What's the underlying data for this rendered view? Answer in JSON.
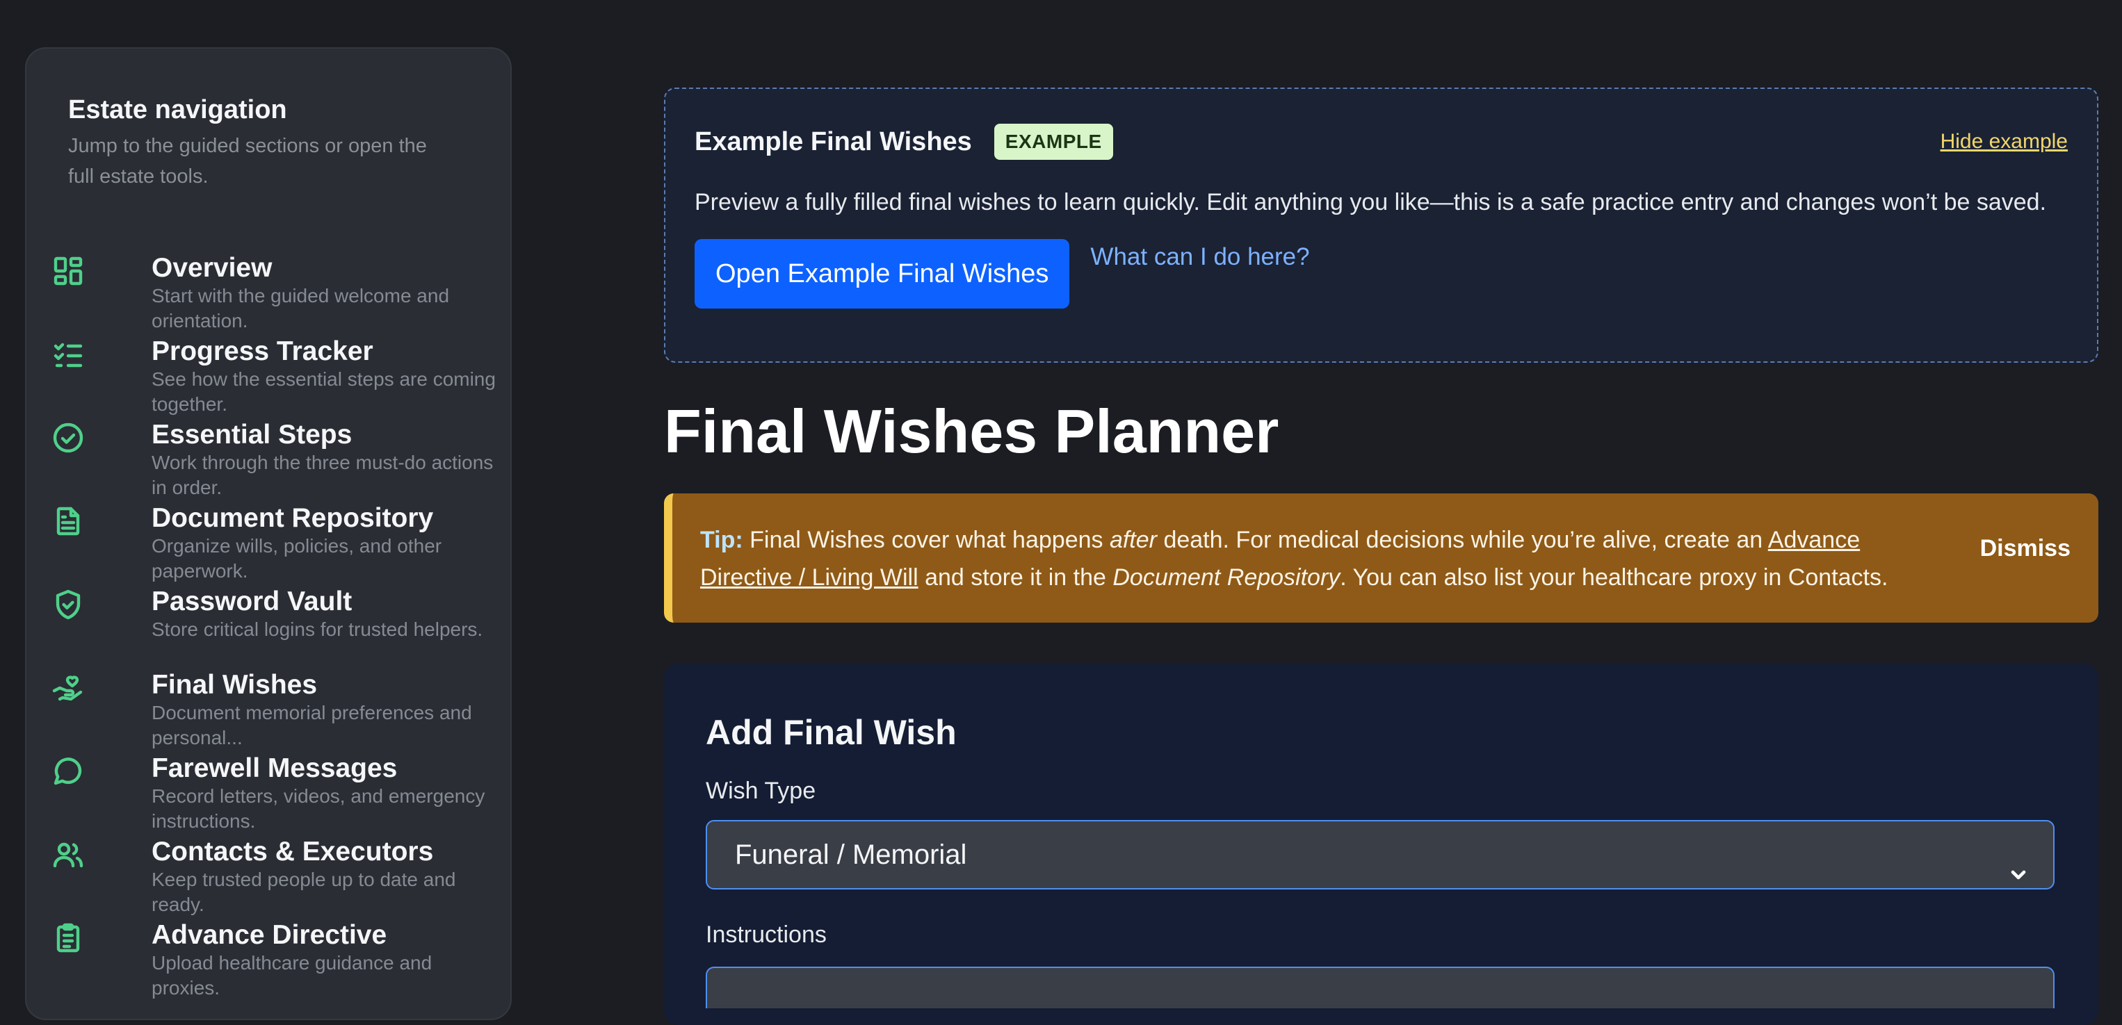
{
  "sidebar": {
    "title": "Estate navigation",
    "subtitle": "Jump to the guided sections or open the full estate tools.",
    "items": [
      {
        "label": "Overview",
        "desc": "Start with the guided welcome and orientation.",
        "icon": "grid-icon"
      },
      {
        "label": "Progress Tracker",
        "desc": "See how the essential steps are coming together.",
        "icon": "checklist-icon"
      },
      {
        "label": "Essential Steps",
        "desc": "Work through the three must-do actions in order.",
        "icon": "check-circle-icon"
      },
      {
        "label": "Document Repository",
        "desc": "Organize wills, policies, and other paperwork.",
        "icon": "file-icon"
      },
      {
        "label": "Password Vault",
        "desc": "Store critical logins for trusted helpers.",
        "icon": "shield-check-icon"
      },
      {
        "label": "Final Wishes",
        "desc": "Document memorial preferences and personal...",
        "icon": "hand-heart-icon"
      },
      {
        "label": "Farewell Messages",
        "desc": "Record letters, videos, and emergency instructions.",
        "icon": "message-icon"
      },
      {
        "label": "Contacts & Executors",
        "desc": "Keep trusted people up to date and ready.",
        "icon": "users-icon"
      },
      {
        "label": "Advance Directive",
        "desc": "Upload healthcare guidance and proxies.",
        "icon": "clipboard-icon"
      }
    ]
  },
  "example": {
    "title": "Example Final Wishes",
    "badge": "EXAMPLE",
    "hide_label": "Hide example",
    "description": "Preview a fully filled final wishes to learn quickly. Edit anything you like—this is a safe practice entry and changes won’t be saved.",
    "open_label": "Open Example Final Wishes",
    "what_label": "What can I do here?"
  },
  "page_title": "Final Wishes Planner",
  "tip": {
    "lead": "Tip:",
    "part1": " Final Wishes cover what happens ",
    "em1": "after",
    "part2": " death. For medical decisions while you’re alive, create an ",
    "link": "Advance Directive / Living Will",
    "part3": " and store it in the ",
    "em2": "Document Repository",
    "part4": ". You can also list your healthcare proxy in Contacts.",
    "dismiss_label": "Dismiss"
  },
  "form": {
    "title": "Add Final Wish",
    "wish_type_label": "Wish Type",
    "wish_type_value": "Funeral / Memorial",
    "instructions_label": "Instructions"
  },
  "colors": {
    "accent_green": "#4fd08a",
    "primary_blue": "#0d62ff",
    "tip_bg": "#8f5a17",
    "tip_border": "#f2c94c"
  }
}
